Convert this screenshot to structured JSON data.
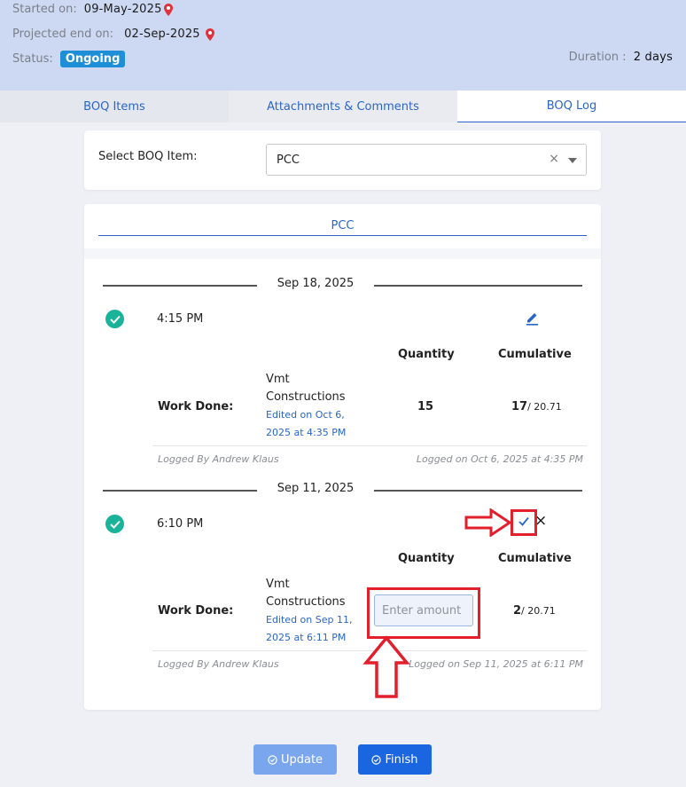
{
  "header": {
    "started_label": "Started on:",
    "started_value": "09-May-2025",
    "projected_label": "Projected end on:",
    "projected_value": "02-Sep-2025",
    "status_label": "Status:",
    "status_value": "Ongoing",
    "duration_label": "Duration :",
    "duration_value": "2 days",
    "accent_color": "#cdd9f3"
  },
  "tabs": [
    {
      "label": "BOQ Items",
      "active": false
    },
    {
      "label": "Attachments & Comments",
      "active": false
    },
    {
      "label": "BOQ Log",
      "active": true
    }
  ],
  "select_boq": {
    "label": "Select BOQ Item:",
    "value": "PCC",
    "clear_icon": "×"
  },
  "log": {
    "title": "PCC",
    "entries": [
      {
        "date": "Sep 18, 2025",
        "time": "4:15 PM",
        "qty_header": "Quantity",
        "cum_header": "Cumulative",
        "work_label": "Work Done:",
        "vendor": "Vmt Constructions",
        "edited": "Edited on Oct 6, 2025 at 4:35 PM",
        "quantity": "15",
        "cumulative": "17",
        "total": "/ 20.71",
        "logged_by": "Logged By Andrew Klaus",
        "logged_on": "Logged on Oct 6, 2025 at 4:35 PM",
        "action_icon": "edit-icon"
      },
      {
        "date": "Sep 11, 2025",
        "time": "6:10 PM",
        "qty_header": "Quantity",
        "cum_header": "Cumulative",
        "work_label": "Work Done:",
        "vendor": "Vmt Constructions",
        "edited": "Edited on Sep 11, 2025 at 6:11 PM",
        "quantity_placeholder": "Enter amount",
        "cumulative": "2",
        "total": "/ 20.71",
        "logged_by": "Logged By Andrew Klaus",
        "logged_on": "Logged on Sep 11, 2025 at 6:11 PM",
        "cancel_icon": "×"
      }
    ]
  },
  "buttons": {
    "update": "Update",
    "finish": "Finish"
  },
  "colors": {
    "primary": "#2a66c6",
    "success": "#19b39a",
    "annotation": "#e21f2b"
  }
}
